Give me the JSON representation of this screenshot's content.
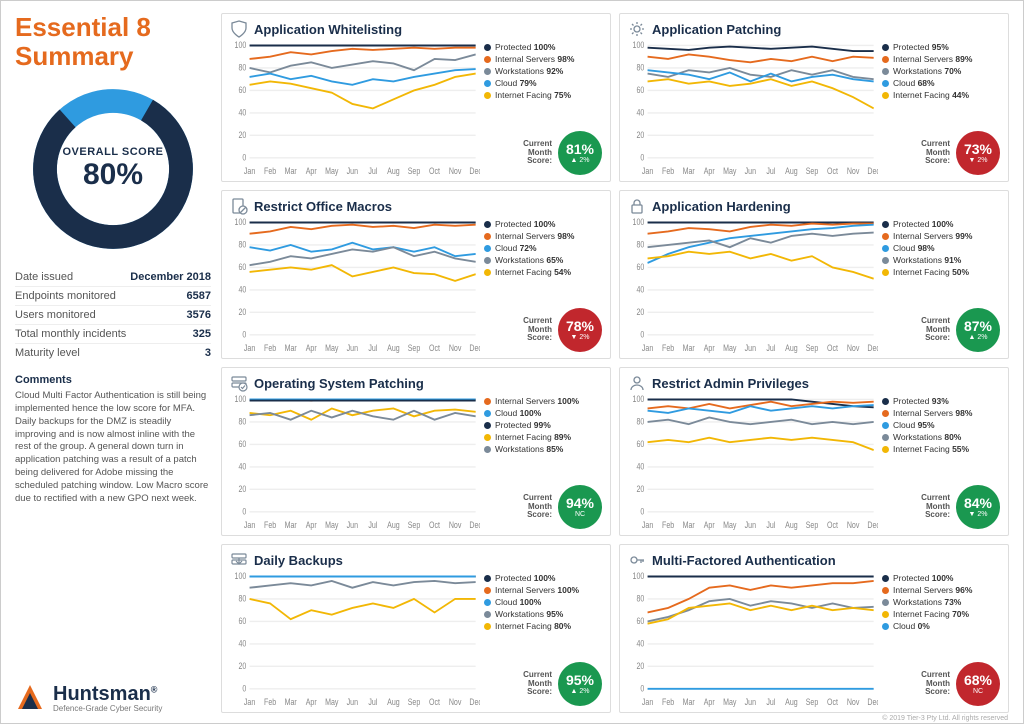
{
  "title": "Essential 8 Summary",
  "overall": {
    "label": "OVERALL SCORE",
    "value": 80,
    "display": "80%"
  },
  "meta": [
    {
      "k": "Date issued",
      "v": "December 2018"
    },
    {
      "k": "Endpoints monitored",
      "v": "6587"
    },
    {
      "k": "Users monitored",
      "v": "3576"
    },
    {
      "k": "Total monthly incidents",
      "v": "325"
    },
    {
      "k": "Maturity level",
      "v": "3"
    }
  ],
  "comments_header": "Comments",
  "comments": "Cloud Multi Factor Authentication is still being implemented hence the low score for MFA. Daily backups for the DMZ is steadily improving and is now almost inline with the rest of the group. A general down turn in application patching was a result of a patch being delivered for Adobe missing the scheduled patching window. Low Macro score due to rectified with a new GPO next week.",
  "brand": {
    "name": "Huntsman",
    "reg": "®",
    "tag": "Defence-Grade Cyber Security"
  },
  "footer": "© 2019 Tier-3 Pty Ltd. All rights reserved",
  "months": [
    "Jan",
    "Feb",
    "Mar",
    "Apr",
    "May",
    "Jun",
    "Jul",
    "Aug",
    "Sep",
    "Oct",
    "Nov",
    "Dec"
  ],
  "yticks": [
    0,
    20,
    40,
    60,
    80,
    100
  ],
  "score_label": "Current Month Score:",
  "colors": {
    "Protected": "#1a2e4a",
    "Internal Servers": "#e56a1e",
    "Workstations": "#7b8a99",
    "Cloud": "#2f9be0",
    "Internet Facing": "#f2b705"
  },
  "chart_data": [
    {
      "id": "app-whitelisting",
      "title": "Application Whitelisting",
      "icon": "shield",
      "type": "line",
      "ylim": [
        0,
        100
      ],
      "score": {
        "value": "81%",
        "delta": "▲ 2%",
        "color": "green"
      },
      "legend": [
        {
          "name": "Protected",
          "pct": "100%"
        },
        {
          "name": "Internal Servers",
          "pct": "98%"
        },
        {
          "name": "Workstations",
          "pct": "92%"
        },
        {
          "name": "Cloud",
          "pct": "79%"
        },
        {
          "name": "Internet Facing",
          "pct": "75%"
        }
      ],
      "series": [
        {
          "name": "Protected",
          "values": [
            100,
            100,
            100,
            100,
            100,
            100,
            100,
            100,
            100,
            100,
            100,
            100
          ]
        },
        {
          "name": "Internal Servers",
          "values": [
            88,
            90,
            94,
            92,
            95,
            97,
            96,
            97,
            98,
            97,
            98,
            98
          ]
        },
        {
          "name": "Workstations",
          "values": [
            80,
            76,
            82,
            85,
            80,
            83,
            86,
            84,
            78,
            88,
            87,
            92
          ]
        },
        {
          "name": "Cloud",
          "values": [
            72,
            75,
            70,
            73,
            68,
            65,
            70,
            68,
            72,
            75,
            78,
            79
          ]
        },
        {
          "name": "Internet Facing",
          "values": [
            65,
            68,
            66,
            62,
            58,
            48,
            44,
            52,
            60,
            65,
            72,
            75
          ]
        }
      ]
    },
    {
      "id": "app-patching",
      "title": "Application Patching",
      "icon": "gear",
      "type": "line",
      "ylim": [
        0,
        100
      ],
      "score": {
        "value": "73%",
        "delta": "▼ 2%",
        "color": "red"
      },
      "legend": [
        {
          "name": "Protected",
          "pct": "95%"
        },
        {
          "name": "Internal Servers",
          "pct": "89%"
        },
        {
          "name": "Workstations",
          "pct": "70%"
        },
        {
          "name": "Cloud",
          "pct": "68%"
        },
        {
          "name": "Internet Facing",
          "pct": "44%"
        }
      ],
      "series": [
        {
          "name": "Protected",
          "values": [
            98,
            97,
            96,
            98,
            99,
            98,
            97,
            98,
            99,
            97,
            95,
            95
          ]
        },
        {
          "name": "Internal Servers",
          "values": [
            90,
            88,
            92,
            90,
            87,
            85,
            88,
            86,
            90,
            86,
            90,
            89
          ]
        },
        {
          "name": "Workstations",
          "values": [
            75,
            72,
            78,
            76,
            80,
            74,
            72,
            78,
            74,
            78,
            72,
            70
          ]
        },
        {
          "name": "Cloud",
          "values": [
            78,
            76,
            74,
            70,
            76,
            68,
            75,
            68,
            72,
            74,
            70,
            68
          ]
        },
        {
          "name": "Internet Facing",
          "values": [
            68,
            70,
            66,
            68,
            64,
            66,
            70,
            64,
            68,
            62,
            54,
            44
          ]
        }
      ]
    },
    {
      "id": "restrict-macros",
      "title": "Restrict Office Macros",
      "icon": "doc-block",
      "type": "line",
      "ylim": [
        0,
        100
      ],
      "score": {
        "value": "78%",
        "delta": "▼ 2%",
        "color": "red"
      },
      "legend": [
        {
          "name": "Protected",
          "pct": "100%"
        },
        {
          "name": "Internal Servers",
          "pct": "98%"
        },
        {
          "name": "Cloud",
          "pct": "72%"
        },
        {
          "name": "Workstations",
          "pct": "65%"
        },
        {
          "name": "Internet Facing",
          "pct": "54%"
        }
      ],
      "series": [
        {
          "name": "Protected",
          "values": [
            100,
            100,
            100,
            100,
            100,
            100,
            100,
            100,
            100,
            100,
            100,
            100
          ]
        },
        {
          "name": "Internal Servers",
          "values": [
            90,
            92,
            96,
            94,
            97,
            98,
            96,
            97,
            95,
            98,
            97,
            98
          ]
        },
        {
          "name": "Cloud",
          "values": [
            78,
            75,
            80,
            74,
            76,
            82,
            76,
            78,
            74,
            78,
            70,
            72
          ]
        },
        {
          "name": "Workstations",
          "values": [
            62,
            65,
            70,
            68,
            72,
            76,
            74,
            78,
            70,
            74,
            68,
            65
          ]
        },
        {
          "name": "Internet Facing",
          "values": [
            56,
            58,
            60,
            58,
            62,
            52,
            56,
            60,
            55,
            54,
            48,
            54
          ]
        }
      ]
    },
    {
      "id": "app-hardening",
      "title": "Application Hardening",
      "icon": "lock",
      "type": "line",
      "ylim": [
        0,
        100
      ],
      "score": {
        "value": "87%",
        "delta": "▲ 2%",
        "color": "green"
      },
      "legend": [
        {
          "name": "Protected",
          "pct": "100%"
        },
        {
          "name": "Internal Servers",
          "pct": "99%"
        },
        {
          "name": "Cloud",
          "pct": "98%"
        },
        {
          "name": "Workstations",
          "pct": "91%"
        },
        {
          "name": "Internet Facing",
          "pct": "50%"
        }
      ],
      "series": [
        {
          "name": "Protected",
          "values": [
            100,
            100,
            100,
            100,
            100,
            100,
            100,
            100,
            100,
            100,
            100,
            100
          ]
        },
        {
          "name": "Internal Servers",
          "values": [
            90,
            92,
            95,
            94,
            92,
            96,
            98,
            97,
            99,
            98,
            99,
            99
          ]
        },
        {
          "name": "Cloud",
          "values": [
            64,
            72,
            78,
            82,
            86,
            88,
            90,
            92,
            94,
            95,
            97,
            98
          ]
        },
        {
          "name": "Workstations",
          "values": [
            78,
            80,
            82,
            84,
            78,
            86,
            82,
            88,
            90,
            88,
            90,
            91
          ]
        },
        {
          "name": "Internet Facing",
          "values": [
            68,
            70,
            74,
            72,
            74,
            68,
            72,
            66,
            70,
            60,
            56,
            50
          ]
        }
      ]
    },
    {
      "id": "os-patching",
      "title": "Operating System Patching",
      "icon": "server-check",
      "type": "line",
      "ylim": [
        0,
        100
      ],
      "score": {
        "value": "94%",
        "delta": "NC",
        "color": "green"
      },
      "legend": [
        {
          "name": "Internal Servers",
          "pct": "100%"
        },
        {
          "name": "Cloud",
          "pct": "100%"
        },
        {
          "name": "Protected",
          "pct": "99%"
        },
        {
          "name": "Internet Facing",
          "pct": "89%"
        },
        {
          "name": "Workstations",
          "pct": "85%"
        }
      ],
      "series": [
        {
          "name": "Internal Servers",
          "values": [
            100,
            100,
            100,
            99,
            100,
            100,
            100,
            100,
            100,
            100,
            100,
            100
          ]
        },
        {
          "name": "Cloud",
          "values": [
            100,
            100,
            100,
            100,
            100,
            100,
            100,
            100,
            100,
            100,
            100,
            100
          ]
        },
        {
          "name": "Protected",
          "values": [
            99,
            99,
            99,
            99,
            99,
            99,
            99,
            99,
            99,
            99,
            99,
            99
          ]
        },
        {
          "name": "Internet Facing",
          "values": [
            88,
            86,
            90,
            82,
            92,
            86,
            90,
            92,
            85,
            90,
            91,
            89
          ]
        },
        {
          "name": "Workstations",
          "values": [
            86,
            88,
            82,
            90,
            84,
            90,
            85,
            82,
            90,
            82,
            88,
            85
          ]
        }
      ]
    },
    {
      "id": "restrict-admin",
      "title": "Restrict Admin Privileges",
      "icon": "user",
      "type": "line",
      "ylim": [
        0,
        100
      ],
      "score": {
        "value": "84%",
        "delta": "▼ 2%",
        "color": "green"
      },
      "legend": [
        {
          "name": "Protected",
          "pct": "93%"
        },
        {
          "name": "Internal Servers",
          "pct": "98%"
        },
        {
          "name": "Cloud",
          "pct": "95%"
        },
        {
          "name": "Workstations",
          "pct": "80%"
        },
        {
          "name": "Internet Facing",
          "pct": "55%"
        }
      ],
      "series": [
        {
          "name": "Protected",
          "values": [
            100,
            100,
            100,
            100,
            100,
            100,
            100,
            100,
            98,
            96,
            94,
            93
          ]
        },
        {
          "name": "Internal Servers",
          "values": [
            92,
            94,
            92,
            96,
            92,
            95,
            98,
            94,
            96,
            98,
            97,
            98
          ]
        },
        {
          "name": "Cloud",
          "values": [
            90,
            88,
            92,
            90,
            88,
            94,
            90,
            92,
            94,
            92,
            94,
            95
          ]
        },
        {
          "name": "Workstations",
          "values": [
            80,
            82,
            78,
            84,
            80,
            78,
            80,
            82,
            78,
            80,
            78,
            80
          ]
        },
        {
          "name": "Internet Facing",
          "values": [
            62,
            64,
            62,
            66,
            62,
            64,
            66,
            64,
            66,
            64,
            62,
            55
          ]
        }
      ]
    },
    {
      "id": "daily-backups",
      "title": "Daily Backups",
      "icon": "backup",
      "type": "line",
      "ylim": [
        0,
        100
      ],
      "score": {
        "value": "95%",
        "delta": "▲ 2%",
        "color": "green"
      },
      "legend": [
        {
          "name": "Protected",
          "pct": "100%"
        },
        {
          "name": "Internal Servers",
          "pct": "100%"
        },
        {
          "name": "Cloud",
          "pct": "100%"
        },
        {
          "name": "Workstations",
          "pct": "95%"
        },
        {
          "name": "Internet Facing",
          "pct": "80%"
        }
      ],
      "series": [
        {
          "name": "Protected",
          "values": [
            100,
            100,
            100,
            100,
            100,
            100,
            100,
            100,
            100,
            100,
            100,
            100
          ]
        },
        {
          "name": "Internal Servers",
          "values": [
            100,
            100,
            100,
            100,
            100,
            100,
            100,
            100,
            100,
            100,
            100,
            100
          ]
        },
        {
          "name": "Cloud",
          "values": [
            100,
            100,
            100,
            100,
            100,
            100,
            100,
            100,
            100,
            100,
            100,
            100
          ]
        },
        {
          "name": "Workstations",
          "values": [
            90,
            92,
            94,
            92,
            96,
            90,
            95,
            92,
            95,
            96,
            94,
            95
          ]
        },
        {
          "name": "Internet Facing",
          "values": [
            80,
            76,
            62,
            70,
            66,
            72,
            76,
            72,
            80,
            68,
            80,
            80
          ]
        }
      ]
    },
    {
      "id": "mfa",
      "title": "Multi-Factored Authentication",
      "icon": "key",
      "type": "line",
      "ylim": [
        0,
        100
      ],
      "score": {
        "value": "68%",
        "delta": "NC",
        "color": "red"
      },
      "legend": [
        {
          "name": "Protected",
          "pct": "100%"
        },
        {
          "name": "Internal Servers",
          "pct": "96%"
        },
        {
          "name": "Workstations",
          "pct": "73%"
        },
        {
          "name": "Internet Facing",
          "pct": "70%"
        },
        {
          "name": "Cloud",
          "pct": "0%"
        }
      ],
      "series": [
        {
          "name": "Protected",
          "values": [
            100,
            100,
            100,
            100,
            100,
            100,
            100,
            100,
            100,
            100,
            100,
            100
          ]
        },
        {
          "name": "Internal Servers",
          "values": [
            68,
            72,
            80,
            90,
            92,
            88,
            92,
            90,
            92,
            94,
            94,
            96
          ]
        },
        {
          "name": "Workstations",
          "values": [
            60,
            64,
            70,
            78,
            80,
            74,
            78,
            76,
            72,
            76,
            72,
            73
          ]
        },
        {
          "name": "Internet Facing",
          "values": [
            58,
            62,
            72,
            74,
            76,
            70,
            74,
            70,
            74,
            70,
            72,
            70
          ]
        },
        {
          "name": "Cloud",
          "values": [
            0,
            0,
            0,
            0,
            0,
            0,
            0,
            0,
            0,
            0,
            0,
            0
          ]
        }
      ]
    }
  ]
}
